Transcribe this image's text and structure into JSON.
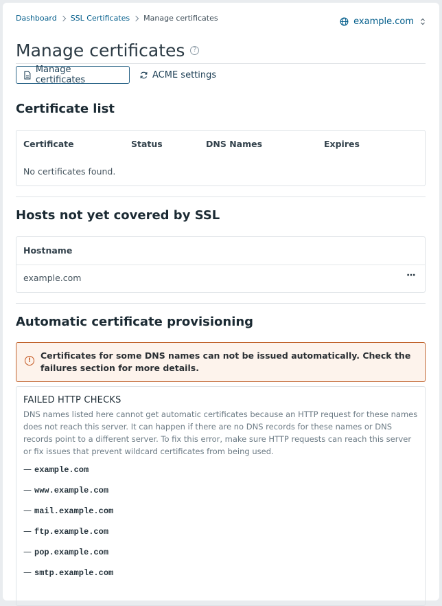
{
  "breadcrumb": {
    "items": [
      "Dashboard",
      "SSL Certificates",
      "Manage certificates"
    ]
  },
  "domain_switch": {
    "label": "example.com"
  },
  "page": {
    "title": "Manage certificates"
  },
  "tabs": [
    {
      "label": "Manage certificates",
      "active": true
    },
    {
      "label": "ACME settings",
      "active": false
    }
  ],
  "certificate_list": {
    "heading": "Certificate list",
    "columns": [
      "Certificate",
      "Status",
      "DNS Names",
      "Expires"
    ],
    "empty_text": "No certificates found."
  },
  "uncovered_hosts": {
    "heading": "Hosts not yet covered by SSL",
    "column": "Hostname",
    "rows": [
      "example.com"
    ],
    "more_label": "···"
  },
  "provisioning": {
    "heading": "Automatic certificate provisioning",
    "warning": "Certificates for some DNS names can not be issued automatically. Check the failures section for more details.",
    "failed_title": "FAILED HTTP CHECKS",
    "failed_desc": "DNS names listed here cannot get automatic certificates because an HTTP request for these names does not reach this server. It can happen if there are no DNS records for these names or DNS records point to a different server. To fix this error, make sure HTTP requests can reach this server or fix issues that prevent wildcard certificates from being used.",
    "hosts": [
      "example.com",
      "www.example.com",
      "mail.example.com",
      "ftp.example.com",
      "pop.example.com",
      "smtp.example.com"
    ],
    "dash": "—"
  },
  "colors": {
    "link": "#005c8a",
    "warning_border": "#c0622c",
    "warning_bg": "#fdf3ec"
  }
}
